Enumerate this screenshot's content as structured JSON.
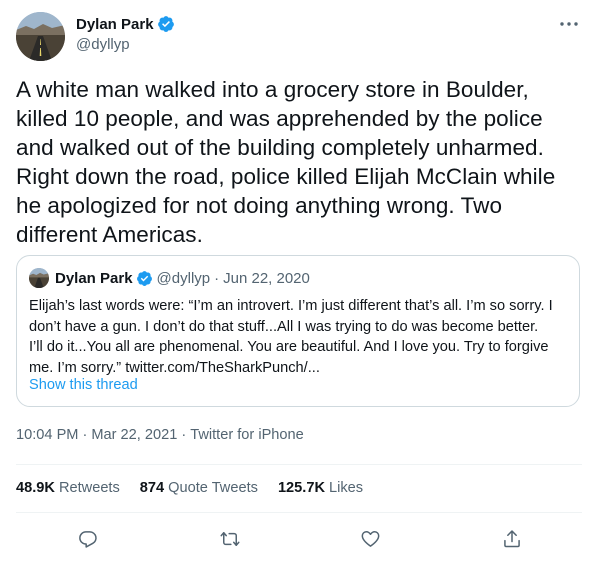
{
  "tweet": {
    "author": {
      "display_name": "Dylan Park",
      "handle": "@dyllyp",
      "verified": true
    },
    "text_lines": [
      "A white man walked into a grocery store in Boulder,",
      "killed 10 people, and was apprehended by the police",
      "and walked out of the building completely unharmed.",
      "Right down the road, police killed Elijah McClain while",
      "he apologized for not doing anything wrong. Two",
      "different Americas."
    ],
    "quote": {
      "display_name": "Dylan Park",
      "handle": "@dyllyp",
      "separator": "·",
      "date": "Jun 22, 2020",
      "text_lines": [
        "Elijah’s last words were: “I’m an introvert. I’m just different that’s all. I’m so sorry. I",
        "don’t have a gun. I don’t do that stuff...All I was trying to do was become better.",
        "I’ll do it...You all are phenomenal. You are beautiful. And I love you. Try to forgive",
        "me. I’m sorry.” twitter.com/TheSharkPunch/..."
      ],
      "show_thread": "Show this thread"
    },
    "meta": {
      "time": "10:04 PM",
      "separator": "·",
      "date": "Mar 22, 2021",
      "source": "Twitter for iPhone"
    },
    "stats": {
      "retweets_count": "48.9K",
      "retweets_label": "Retweets",
      "quotes_count": "874",
      "quotes_label": "Quote Tweets",
      "likes_count": "125.7K",
      "likes_label": "Likes"
    },
    "actions": {
      "reply_icon": "reply-icon",
      "retweet_icon": "retweet-icon",
      "like_icon": "heart-icon",
      "share_icon": "share-icon"
    }
  },
  "colors": {
    "accent": "#1d9bf0",
    "text_primary": "#0f1419",
    "text_secondary": "#536471",
    "border": "#cfd9de",
    "divider": "#eff3f4"
  }
}
